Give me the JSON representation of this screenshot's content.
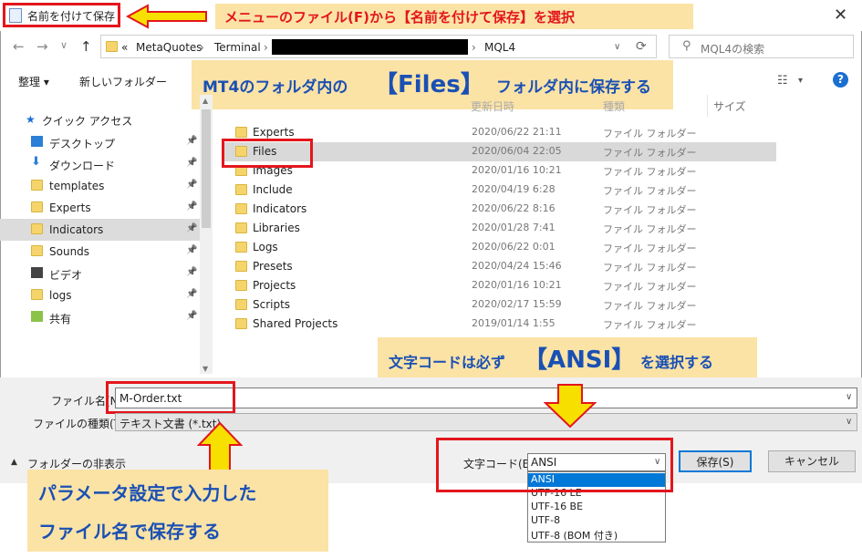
{
  "window": {
    "title": "名前を付けて保存"
  },
  "address": {
    "back": "←",
    "forward": "→",
    "recent": "∨",
    "up": "↑",
    "prefix": "«",
    "crumbs": [
      "MetaQuotes",
      "Terminal",
      "MQL4"
    ],
    "refresh": "⟳",
    "search_placeholder": "MQL4の検索"
  },
  "toolbar": {
    "organize": "整理 ▾",
    "new_folder": "新しいフォルダー"
  },
  "nav": {
    "quick_access": "クイック アクセス",
    "items": [
      {
        "label": "デスクトップ",
        "icon": "desktop-icon"
      },
      {
        "label": "ダウンロード",
        "icon": "download-icon"
      },
      {
        "label": "templates",
        "icon": "folder-icon"
      },
      {
        "label": "Experts",
        "icon": "folder-icon"
      },
      {
        "label": "Indicators",
        "icon": "folder-icon",
        "selected": true
      },
      {
        "label": "Sounds",
        "icon": "folder-icon"
      },
      {
        "label": "ビデオ",
        "icon": "video-icon"
      },
      {
        "label": "logs",
        "icon": "folder-icon"
      },
      {
        "label": "共有",
        "icon": "share-icon"
      }
    ]
  },
  "columns": {
    "date": "更新日時",
    "type": "種類",
    "size": "サイズ"
  },
  "files": [
    {
      "name": "Experts",
      "date": "2020/06/22 21:11",
      "type": "ファイル フォルダー"
    },
    {
      "name": "Files",
      "date": "2020/06/04 22:05",
      "type": "ファイル フォルダー",
      "selected": true
    },
    {
      "name": "Images",
      "date": "2020/01/16 10:21",
      "type": "ファイル フォルダー"
    },
    {
      "name": "Include",
      "date": "2020/04/19 6:28",
      "type": "ファイル フォルダー"
    },
    {
      "name": "Indicators",
      "date": "2020/06/22 8:16",
      "type": "ファイル フォルダー"
    },
    {
      "name": "Libraries",
      "date": "2020/01/28 7:41",
      "type": "ファイル フォルダー"
    },
    {
      "name": "Logs",
      "date": "2020/06/22 0:01",
      "type": "ファイル フォルダー"
    },
    {
      "name": "Presets",
      "date": "2020/04/24 15:46",
      "type": "ファイル フォルダー"
    },
    {
      "name": "Projects",
      "date": "2020/01/16 10:21",
      "type": "ファイル フォルダー"
    },
    {
      "name": "Scripts",
      "date": "2020/02/17 15:59",
      "type": "ファイル フォルダー"
    },
    {
      "name": "Shared Projects",
      "date": "2019/01/14 1:55",
      "type": "ファイル フォルダー"
    }
  ],
  "form": {
    "filename_label": "ファイル名(N):",
    "filename_value": "M-Order.txt",
    "filetype_label": "ファイルの種類(T):",
    "filetype_value": "テキスト文書 (*.txt)",
    "hide_folders": "フォルダーの非表示",
    "encoding_label": "文字コード(E):",
    "encoding_value": "ANSI",
    "encoding_options": [
      "ANSI",
      "UTF-16 LE",
      "UTF-16 BE",
      "UTF-8",
      "UTF-8 (BOM 付き)"
    ],
    "save": "保存(S)",
    "cancel": "キャンセル"
  },
  "annotations": {
    "title_note": "メニューのファイル(F)から【名前を付けて保存】を選択",
    "folder_note_a": "MT4のフォルダ内の",
    "folder_note_b": "【Files】",
    "folder_note_c": "フォルダ内に保存する",
    "encoding_note_a": "文字コードは必ず",
    "encoding_note_b": "【ANSI】",
    "encoding_note_c": "を選択する",
    "filename_note_line1": "パラメータ設定で入力した",
    "filename_note_line2": "ファイル名で保存する"
  },
  "colors": {
    "highlight": "#e3161c",
    "note_bg": "#fbe3a6",
    "note_text": "#1a50b4",
    "arrow": "#f7e000",
    "selected_option": "#0078d7"
  }
}
